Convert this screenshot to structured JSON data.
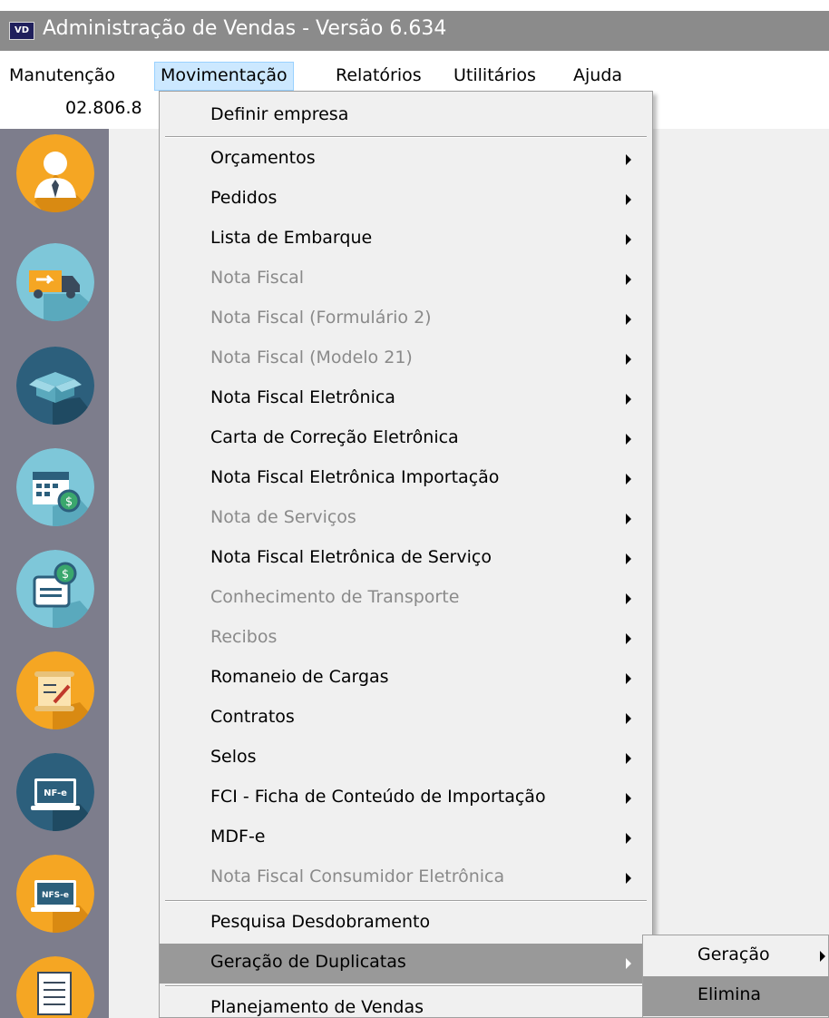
{
  "window": {
    "icon_text": "VD",
    "title": "Administração de Vendas - Versão 6.634"
  },
  "menubar": {
    "items": [
      {
        "label": "Manutenção"
      },
      {
        "label": "Movimentação"
      },
      {
        "label": "Relatórios"
      },
      {
        "label": "Utilitários"
      },
      {
        "label": "Ajuda"
      }
    ]
  },
  "toolbar": {
    "code": "02.806.8"
  },
  "sidebar": {
    "icons": [
      {
        "name": "user-icon"
      },
      {
        "name": "delivery-truck-icon"
      },
      {
        "name": "box-icon"
      },
      {
        "name": "calendar-money-icon"
      },
      {
        "name": "invoice-money-icon"
      },
      {
        "name": "contract-icon"
      },
      {
        "name": "nfe-icon"
      },
      {
        "name": "nfse-icon"
      },
      {
        "name": "checklist-icon"
      }
    ]
  },
  "dropdown": {
    "items": [
      {
        "label": "Definir empresa",
        "enabled": true,
        "submenu": false
      },
      {
        "label": "Orçamentos",
        "enabled": true,
        "submenu": true
      },
      {
        "label": "Pedidos",
        "enabled": true,
        "submenu": true
      },
      {
        "label": "Lista de Embarque",
        "enabled": true,
        "submenu": true
      },
      {
        "label": "Nota Fiscal",
        "enabled": false,
        "submenu": true
      },
      {
        "label": "Nota Fiscal (Formulário 2)",
        "enabled": false,
        "submenu": true
      },
      {
        "label": "Nota Fiscal (Modelo 21)",
        "enabled": false,
        "submenu": true
      },
      {
        "label": "Nota Fiscal Eletrônica",
        "enabled": true,
        "submenu": true
      },
      {
        "label": "Carta de Correção Eletrônica",
        "enabled": true,
        "submenu": true
      },
      {
        "label": "Nota Fiscal Eletrônica Importação",
        "enabled": true,
        "submenu": true
      },
      {
        "label": "Nota de Serviços",
        "enabled": false,
        "submenu": true
      },
      {
        "label": "Nota Fiscal Eletrônica de Serviço",
        "enabled": true,
        "submenu": true
      },
      {
        "label": "Conhecimento de Transporte",
        "enabled": false,
        "submenu": true
      },
      {
        "label": "Recibos",
        "enabled": false,
        "submenu": true
      },
      {
        "label": "Romaneio de Cargas",
        "enabled": true,
        "submenu": true
      },
      {
        "label": "Contratos",
        "enabled": true,
        "submenu": true
      },
      {
        "label": "Selos",
        "enabled": true,
        "submenu": true
      },
      {
        "label": "FCI - Ficha de Conteúdo de Importação",
        "enabled": true,
        "submenu": true
      },
      {
        "label": "MDF-e",
        "enabled": true,
        "submenu": true
      },
      {
        "label": "Nota Fiscal Consumidor Eletrônica",
        "enabled": false,
        "submenu": true
      },
      {
        "label": "Pesquisa Desdobramento",
        "enabled": true,
        "submenu": false
      },
      {
        "label": "Geração de Duplicatas",
        "enabled": true,
        "submenu": true,
        "highlighted": true
      },
      {
        "label": "Planejamento de Vendas",
        "enabled": true,
        "submenu": false
      }
    ]
  },
  "submenu": {
    "items": [
      {
        "label": "Geração",
        "submenu": true
      },
      {
        "label": "Elimina",
        "submenu": false,
        "highlighted": true
      }
    ]
  },
  "colors": {
    "title_band": "#8b8b8b",
    "sidebar_bg": "#7d7d8c",
    "menu_bg": "#f0f0f0",
    "menu_highlight": "#999999",
    "disabled_text": "#8a8a8a",
    "active_menubar_bg": "#cce8ff",
    "icon_orange": "#f5a623",
    "icon_teal": "#7ec7d9",
    "icon_navy": "#2c5f7c"
  }
}
